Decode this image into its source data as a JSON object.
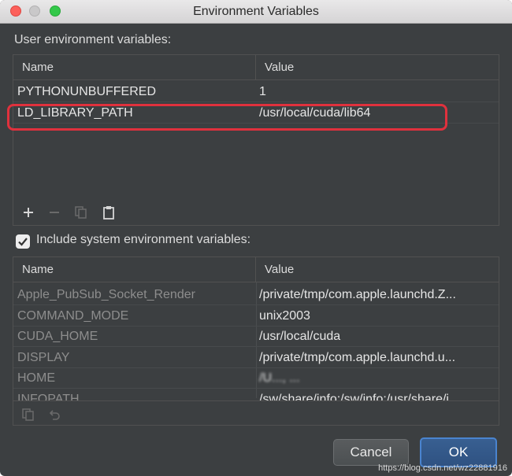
{
  "window": {
    "title": "Environment Variables"
  },
  "user_env": {
    "label": "User environment variables:",
    "columns": {
      "name": "Name",
      "value": "Value"
    },
    "rows": [
      {
        "name": "PYTHONUNBUFFERED",
        "value": "1"
      },
      {
        "name": "LD_LIBRARY_PATH",
        "value": "/usr/local/cuda/lib64"
      }
    ],
    "toolbar": [
      {
        "icon": "plus-icon",
        "symbol": "+"
      },
      {
        "icon": "minus-icon",
        "symbol": "−"
      },
      {
        "icon": "copy-icon"
      },
      {
        "icon": "paste-icon"
      }
    ]
  },
  "include_system": {
    "label": "Include system environment variables:",
    "checked": true
  },
  "system_env": {
    "columns": {
      "name": "Name",
      "value": "Value"
    },
    "rows": [
      {
        "name": "Apple_PubSub_Socket_Render",
        "value": "/private/tmp/com.apple.launchd.Z..."
      },
      {
        "name": "COMMAND_MODE",
        "value": "unix2003"
      },
      {
        "name": "CUDA_HOME",
        "value": "/usr/local/cuda"
      },
      {
        "name": "DISPLAY",
        "value": "/private/tmp/com.apple.launchd.u..."
      },
      {
        "name": "HOME",
        "value": "/U..., ..."
      },
      {
        "name": "INFOPATH",
        "value": "/sw/share/info:/sw/info:/usr/share/i"
      }
    ],
    "toolbar": [
      {
        "icon": "copy-icon"
      },
      {
        "icon": "revert-icon"
      }
    ]
  },
  "buttons": {
    "cancel": "Cancel",
    "ok": "OK"
  },
  "watermark": "https://blog.csdn.net/wz22881916",
  "colors": {
    "background": "#3c3f41",
    "highlight": "#e0313d",
    "ok_border": "#4a84cf"
  }
}
